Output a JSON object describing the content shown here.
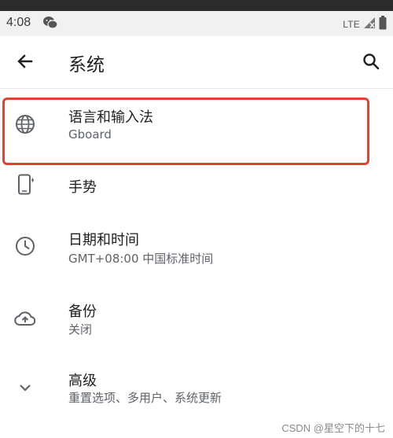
{
  "status_bar": {
    "time": "4:08",
    "network": "LTE"
  },
  "app_bar": {
    "title": "系统"
  },
  "settings_items": [
    {
      "title": "语言和输入法",
      "subtitle": "Gboard",
      "icon": "globe-icon"
    },
    {
      "title": "手势",
      "subtitle": "",
      "icon": "phone-gesture-icon"
    },
    {
      "title": "日期和时间",
      "subtitle": "GMT+08:00 中国标准时间",
      "icon": "clock-icon"
    },
    {
      "title": "备份",
      "subtitle": "关闭",
      "icon": "cloud-upload-icon"
    },
    {
      "title": "高级",
      "subtitle": "重置选项、多用户、系统更新",
      "icon": "chevron-down-icon"
    }
  ],
  "colors": {
    "highlight": "#e0432f",
    "icon": "#5f6368",
    "status_bar_bg": "#f1f1f1"
  },
  "watermark": "CSDN @星空下的十七"
}
